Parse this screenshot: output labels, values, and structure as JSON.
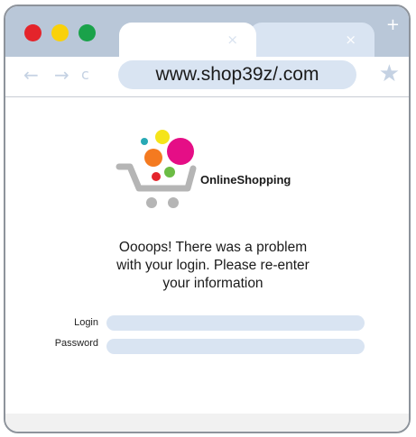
{
  "window_controls": {
    "close_color": "#e4242b",
    "minimize_color": "#f9d10a",
    "maximize_color": "#1aa24a"
  },
  "tabs": [
    {
      "close_glyph": "×"
    },
    {
      "close_glyph": "×"
    }
  ],
  "new_tab_glyph": "+",
  "nav": {
    "back_glyph": "←",
    "forward_glyph": "→",
    "reload_glyph": "c"
  },
  "address": {
    "url": "www.shop39z/.com"
  },
  "bookmark_glyph": "★",
  "brand": {
    "name": "OnlineShopping",
    "logo_colors": [
      "#e50e86",
      "#f47a20",
      "#f5e41a",
      "#28a9b5",
      "#e4242b",
      "#6cbc45",
      "#b5b5b5"
    ]
  },
  "message": {
    "line1": "Oooops! There was a problem",
    "line2": "with your login. Please re-enter",
    "line3": "your information"
  },
  "form": {
    "login_label": "Login",
    "login_value": "",
    "password_label": "Password",
    "password_value": ""
  }
}
